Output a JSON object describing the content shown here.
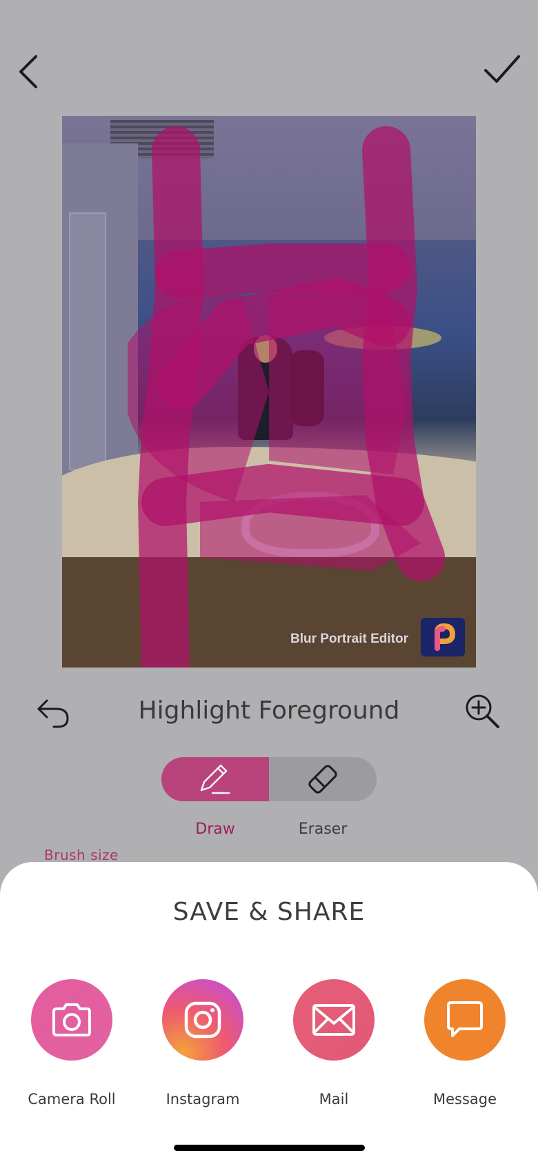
{
  "header": {
    "back_icon": "chevron-left-icon",
    "confirm_icon": "checkmark-icon"
  },
  "photo": {
    "watermark_text": "Blur Portrait Editor",
    "overlay_color": "#b0106a"
  },
  "toolbar": {
    "title": "Highlight Foreground",
    "undo_icon": "undo-icon",
    "zoom_icon": "zoom-in-icon"
  },
  "brush_mode": {
    "selected": "Draw",
    "options": [
      {
        "label": "Draw",
        "icon": "pencil-icon"
      },
      {
        "label": "Eraser",
        "icon": "eraser-icon"
      }
    ],
    "active_color": "#b8447b"
  },
  "brush_size_label": "Brush size",
  "share_sheet": {
    "title": "SAVE & SHARE",
    "items": [
      {
        "label": "Camera Roll",
        "icon": "camera-icon",
        "color": "#e45ca0"
      },
      {
        "label": "Instagram",
        "icon": "instagram-icon",
        "color": "#d6547c"
      },
      {
        "label": "Mail",
        "icon": "mail-icon",
        "color": "#e35876"
      },
      {
        "label": "Message",
        "icon": "message-icon",
        "color": "#f0842c"
      }
    ]
  }
}
